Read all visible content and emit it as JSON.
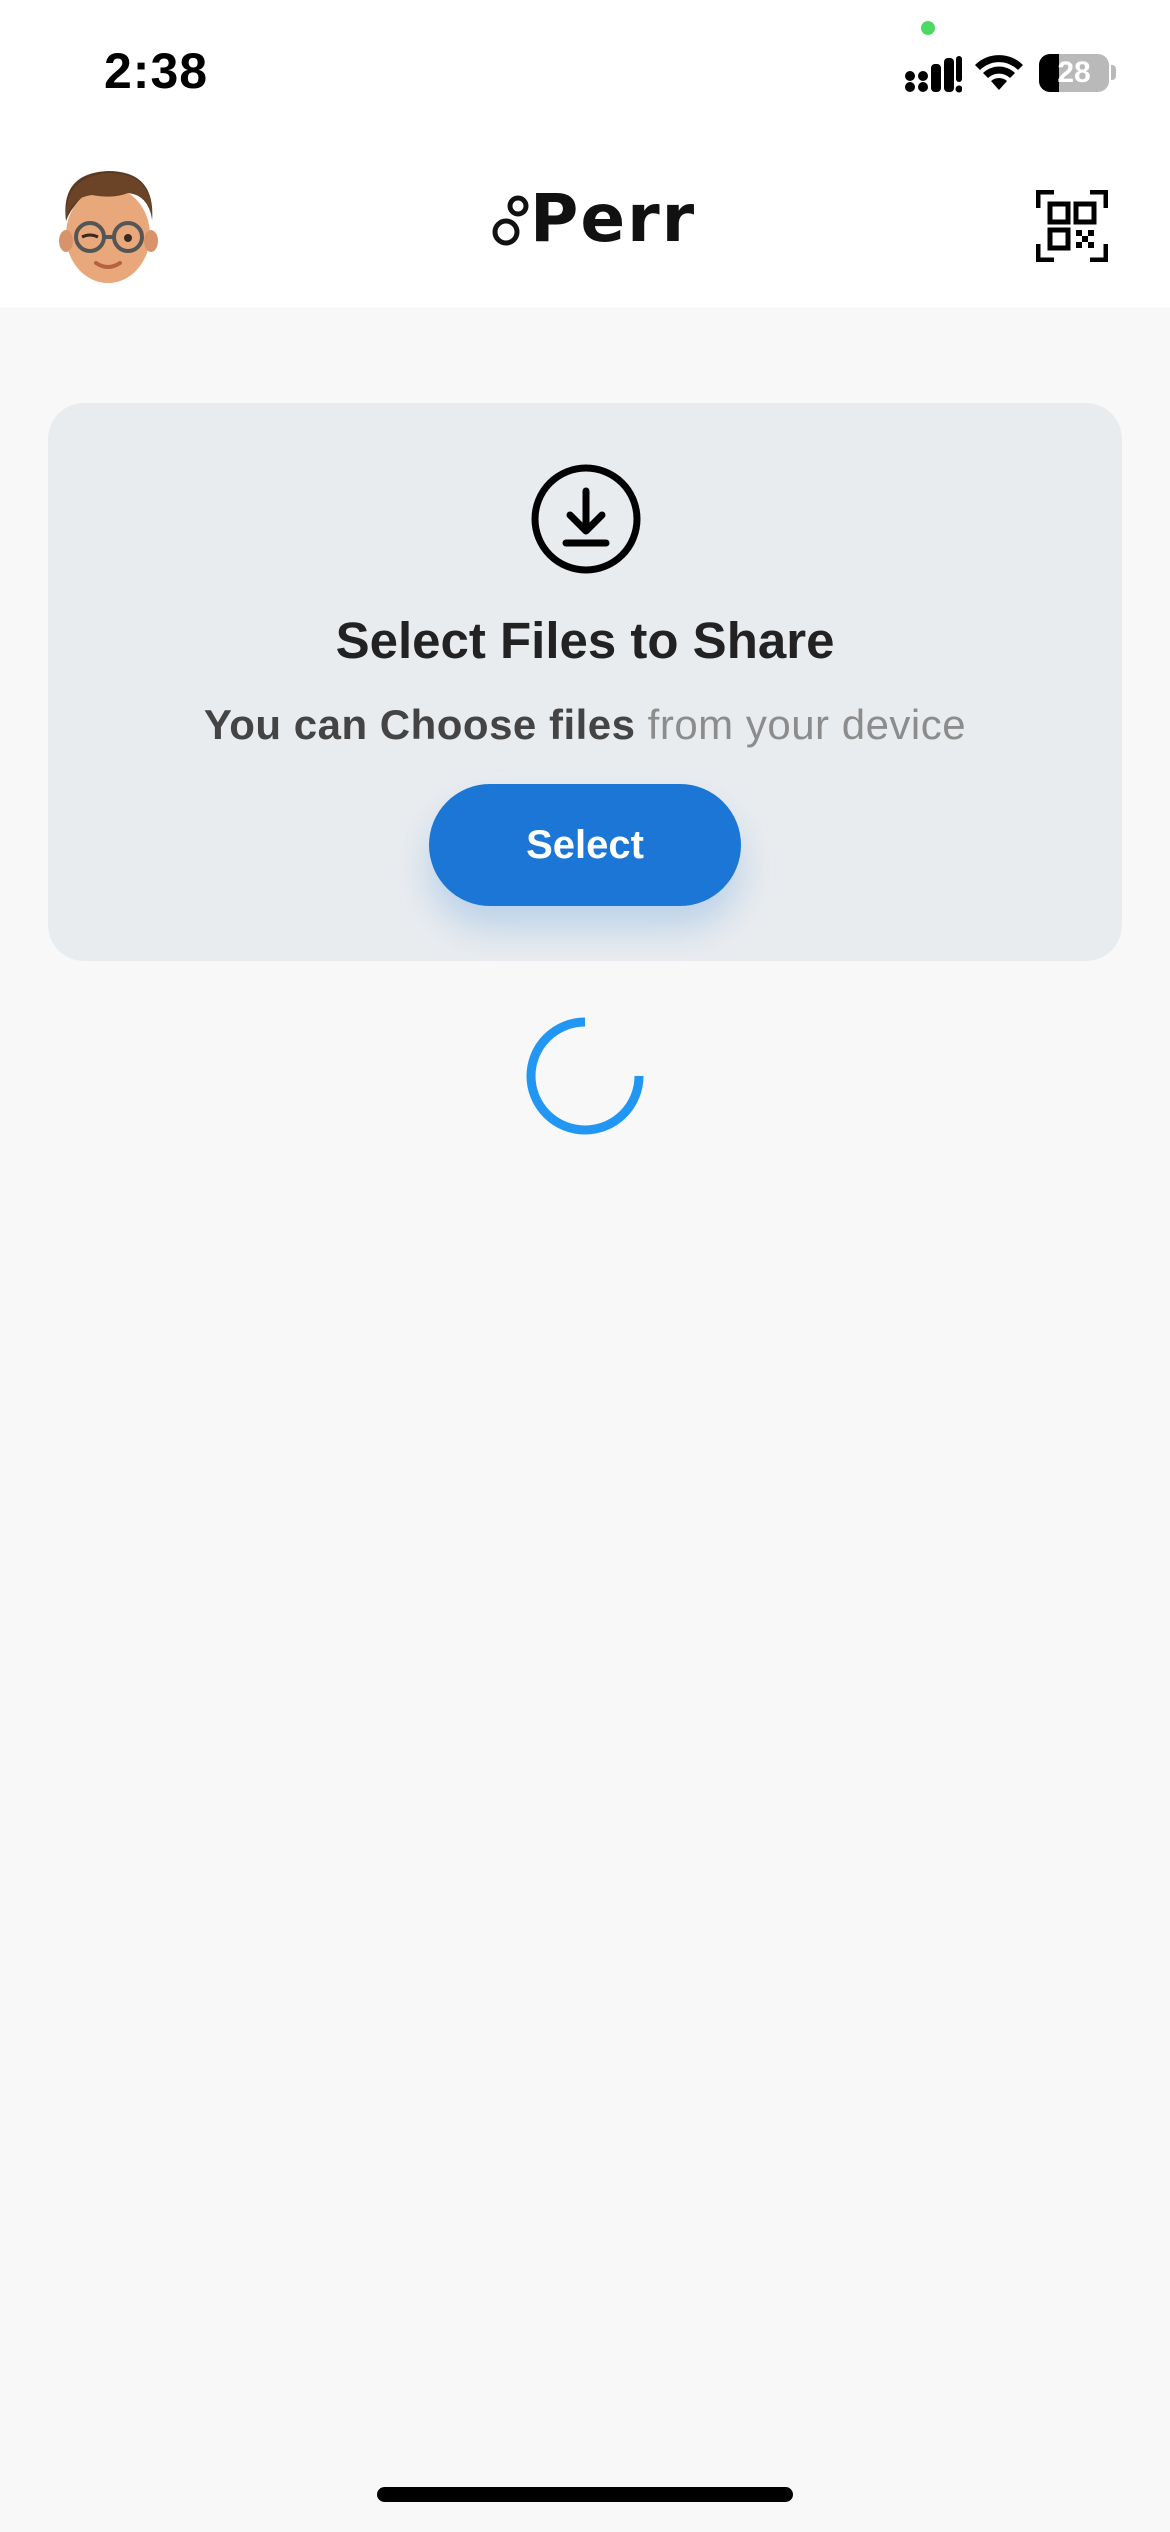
{
  "status_bar": {
    "time": "2:38",
    "battery_level": 28,
    "battery_label": "28",
    "privacy_indicator_color": "#4cd964"
  },
  "header": {
    "logo_text": "Perr",
    "avatar_icon": "memoji-avatar-icon",
    "qr_icon": "qr-scan-icon"
  },
  "card": {
    "icon": "download-circle-icon",
    "title": "Select Files to Share",
    "subtitle_strong": "You can Choose files",
    "subtitle_rest": " from your device",
    "button_label": "Select"
  },
  "colors": {
    "accent": "#1b76d5",
    "spinner": "#2196f3",
    "card_background": "#e9ecef",
    "page_background": "#f8f8f8"
  }
}
